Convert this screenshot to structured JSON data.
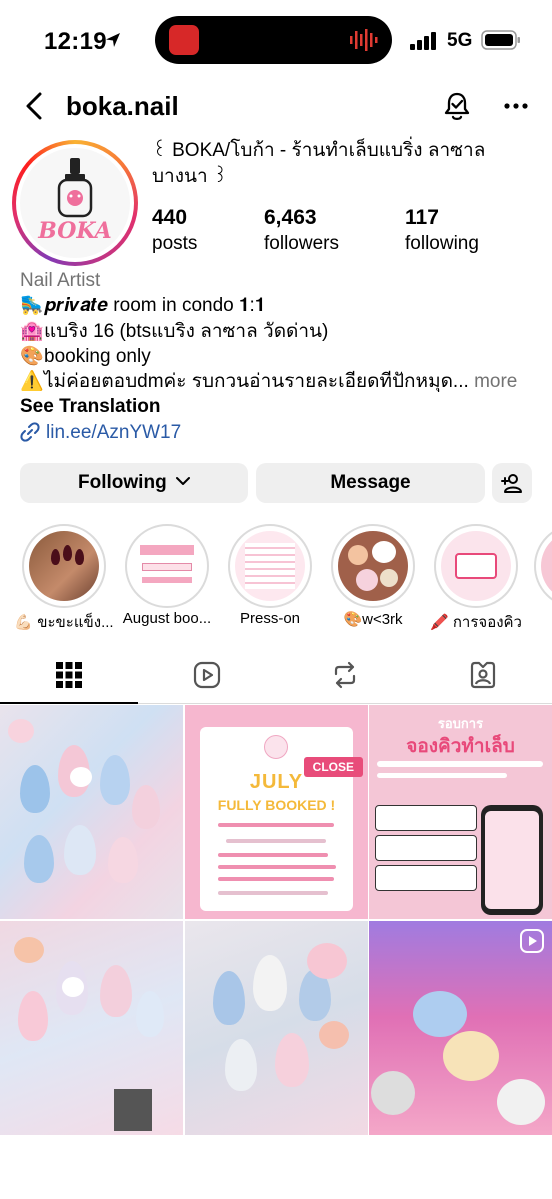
{
  "status_bar": {
    "time": "12:19",
    "network": "5G"
  },
  "header": {
    "username": "boka.nail"
  },
  "profile": {
    "full_name": "꒰ BOKA/โบก้า - ร้านทำเล็บแบริ่ง ลาซาล บางนา ꒱",
    "avatar_text": "BOKA",
    "stats": [
      {
        "value": "440",
        "label": "posts"
      },
      {
        "value": "6,463",
        "label": "followers"
      },
      {
        "value": "117",
        "label": "following"
      }
    ],
    "category": "Nail Artist",
    "bio_lines": [
      {
        "emoji": "🛼",
        "text": "𝒑𝒓𝒊𝒗𝒂𝒕𝒆 room in condo 𝟏:𝟏"
      },
      {
        "emoji": "🏩",
        "text": "แบริ่ง 16 (btsแบริ่ง ลาซาล วัดด่าน)"
      },
      {
        "emoji": "🎨",
        "text": "booking only"
      },
      {
        "emoji": "⚠️",
        "text": "ไม่ค่อยตอบdmค่ะ รบกวนอ่านรายละเอียดที่ปักหมุด..."
      }
    ],
    "more_label": "more",
    "see_translation": "See Translation",
    "link": "lin.ee/AznYW17"
  },
  "buttons": {
    "following": "Following",
    "message": "Message"
  },
  "highlights": [
    {
      "label": "💪🏻 ขะขะแข็ง..."
    },
    {
      "label": "August boo..."
    },
    {
      "label": "Press-on"
    },
    {
      "label": "🎨w<3rk"
    },
    {
      "label": "🖍️ การจองคิว"
    },
    {
      "label": "🍎"
    }
  ],
  "tiles": {
    "t2_close": "CLOSE",
    "t2_title": "JULY",
    "t2_subtitle": "FULLY BOOKED !",
    "t3_title_small": "รอบการ",
    "t3_title_big": "จองคิวทำเล็บ"
  },
  "colors": {
    "link": "#2a5aa6",
    "button_bg": "#efefef",
    "muted": "#737373"
  }
}
